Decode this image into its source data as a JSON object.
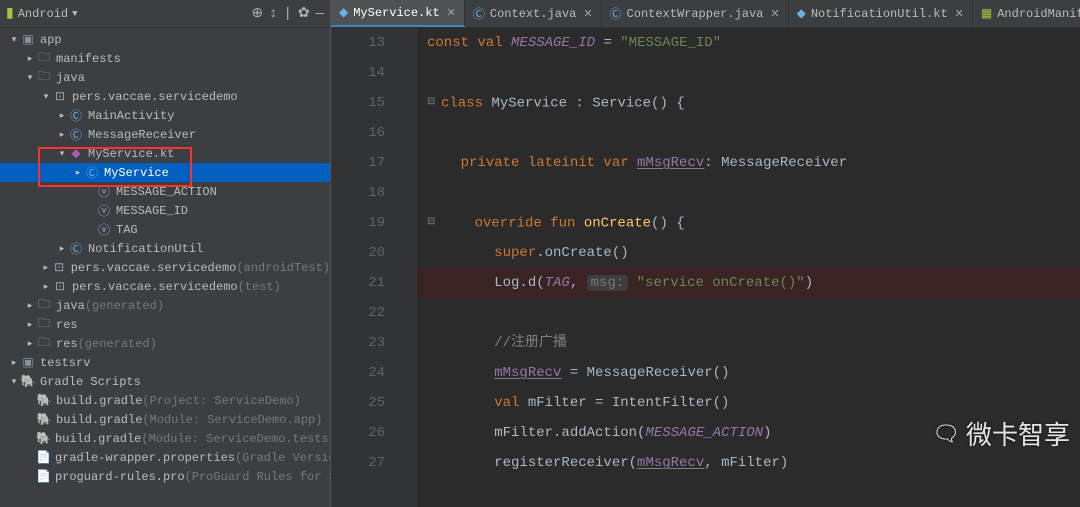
{
  "view": {
    "title": "Android"
  },
  "tree": {
    "app": "app",
    "manifests": "manifests",
    "java": "java",
    "pkg1": "pers.vaccae.servicedemo",
    "mainActivity": "MainActivity",
    "messageReceiver": "MessageReceiver",
    "myServiceKt": "MyService.kt",
    "myService": "MyService",
    "msgAction": "MESSAGE_ACTION",
    "msgId": "MESSAGE_ID",
    "tag": "TAG",
    "notificationUtil": "NotificationUtil",
    "pkgAndroidTest": "pers.vaccae.servicedemo",
    "pkgAndroidTestSuffix": "(androidTest)",
    "pkgTest": "pers.vaccae.servicedemo",
    "pkgTestSuffix": "(test)",
    "javaGen": "java",
    "javaGenSuffix": "(generated)",
    "res": "res",
    "resGen": "res",
    "resGenSuffix": "(generated)",
    "testsrv": "testsrv",
    "gradleScripts": "Gradle Scripts",
    "bg1": "build.gradle",
    "bg1s": "(Project: ServiceDemo)",
    "bg2": "build.gradle",
    "bg2s": "(Module: ServiceDemo.app)",
    "bg3": "build.gradle",
    "bg3s": "(Module: ServiceDemo.testsrv)",
    "gwp": "gradle-wrapper.properties",
    "gwps": "(Gradle Version)",
    "pgr": "proguard-rules.pro",
    "pgrs": "(ProGuard Rules for Servi"
  },
  "tabs": {
    "t1": "MyService.kt",
    "t2": "Context.java",
    "t3": "ContextWrapper.java",
    "t4": "NotificationUtil.kt",
    "t5": "AndroidManifest.xml"
  },
  "code": {
    "ln13": "13",
    "ln14": "14",
    "ln15": "15",
    "ln16": "16",
    "ln17": "17",
    "ln18": "18",
    "ln19": "19",
    "ln20": "20",
    "ln21": "21",
    "ln22": "22",
    "ln23": "23",
    "ln24": "24",
    "ln25": "25",
    "ln26": "26",
    "ln27": "27",
    "l13_const": "const val",
    "l13_name": " MESSAGE_ID",
    "l13_eq": " = ",
    "l13_str": "\"MESSAGE_ID\"",
    "l15_class": "class",
    "l15_name": " MyService : Service() {",
    "l17_kw": "    private lateinit var ",
    "l17_field": "mMsgRecv",
    "l17_type": ": MessageReceiver",
    "l19_kw": "    override fun ",
    "l19_fn": "onCreate",
    "l19_rest": "() {",
    "l20_kw": "        super",
    "l20_call": ".onCreate()",
    "l21_log": "        Log.d(",
    "l21_tag": "TAG",
    "l21_comma": ", ",
    "l21_hint": "msg:",
    "l21_sp": " ",
    "l21_str": "\"service onCreate()\"",
    "l21_close": ")",
    "l23_comment": "        //注册广播",
    "l24_field": "mMsgRecv",
    "l24_rest": " = MessageReceiver()",
    "l24_pre": "        ",
    "l25_kw": "        val",
    "l25_rest": " mFilter = IntentFilter()",
    "l26_pre": "        mFilter.addAction(",
    "l26_const": "MESSAGE_ACTION",
    "l26_close": ")",
    "l27_pre": "        registerReceiver(",
    "l27_field": "mMsgRecv",
    "l27_rest": ", mFilter)"
  },
  "watermark": "微卡智享"
}
